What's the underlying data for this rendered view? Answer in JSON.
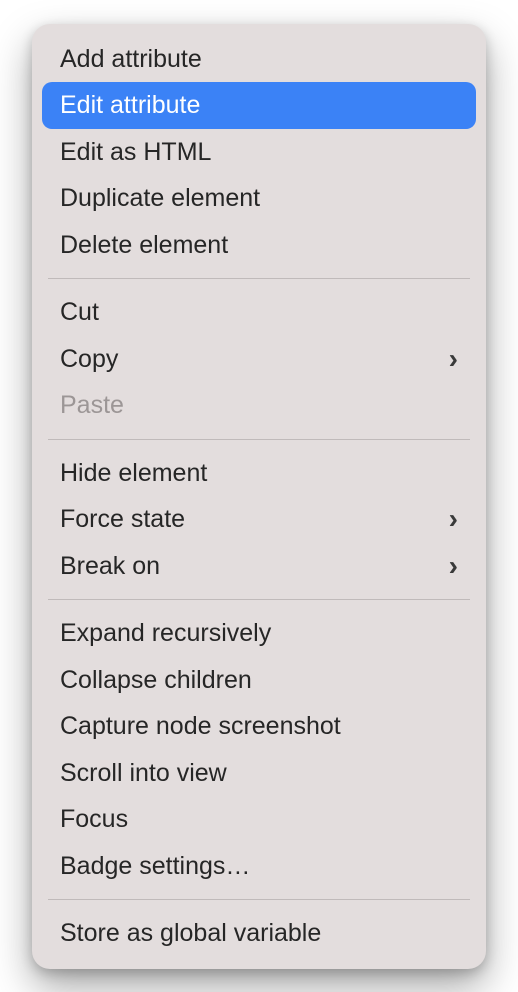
{
  "menu": {
    "group1": [
      {
        "label": "Add attribute",
        "submenu": false,
        "highlighted": false,
        "disabled": false
      },
      {
        "label": "Edit attribute",
        "submenu": false,
        "highlighted": true,
        "disabled": false
      },
      {
        "label": "Edit as HTML",
        "submenu": false,
        "highlighted": false,
        "disabled": false
      },
      {
        "label": "Duplicate element",
        "submenu": false,
        "highlighted": false,
        "disabled": false
      },
      {
        "label": "Delete element",
        "submenu": false,
        "highlighted": false,
        "disabled": false
      }
    ],
    "group2": [
      {
        "label": "Cut",
        "submenu": false,
        "highlighted": false,
        "disabled": false
      },
      {
        "label": "Copy",
        "submenu": true,
        "highlighted": false,
        "disabled": false
      },
      {
        "label": "Paste",
        "submenu": false,
        "highlighted": false,
        "disabled": true
      }
    ],
    "group3": [
      {
        "label": "Hide element",
        "submenu": false,
        "highlighted": false,
        "disabled": false
      },
      {
        "label": "Force state",
        "submenu": true,
        "highlighted": false,
        "disabled": false
      },
      {
        "label": "Break on",
        "submenu": true,
        "highlighted": false,
        "disabled": false
      }
    ],
    "group4": [
      {
        "label": "Expand recursively",
        "submenu": false,
        "highlighted": false,
        "disabled": false
      },
      {
        "label": "Collapse children",
        "submenu": false,
        "highlighted": false,
        "disabled": false
      },
      {
        "label": "Capture node screenshot",
        "submenu": false,
        "highlighted": false,
        "disabled": false
      },
      {
        "label": "Scroll into view",
        "submenu": false,
        "highlighted": false,
        "disabled": false
      },
      {
        "label": "Focus",
        "submenu": false,
        "highlighted": false,
        "disabled": false
      },
      {
        "label": "Badge settings…",
        "submenu": false,
        "highlighted": false,
        "disabled": false
      }
    ],
    "group5": [
      {
        "label": "Store as global variable",
        "submenu": false,
        "highlighted": false,
        "disabled": false
      }
    ]
  }
}
